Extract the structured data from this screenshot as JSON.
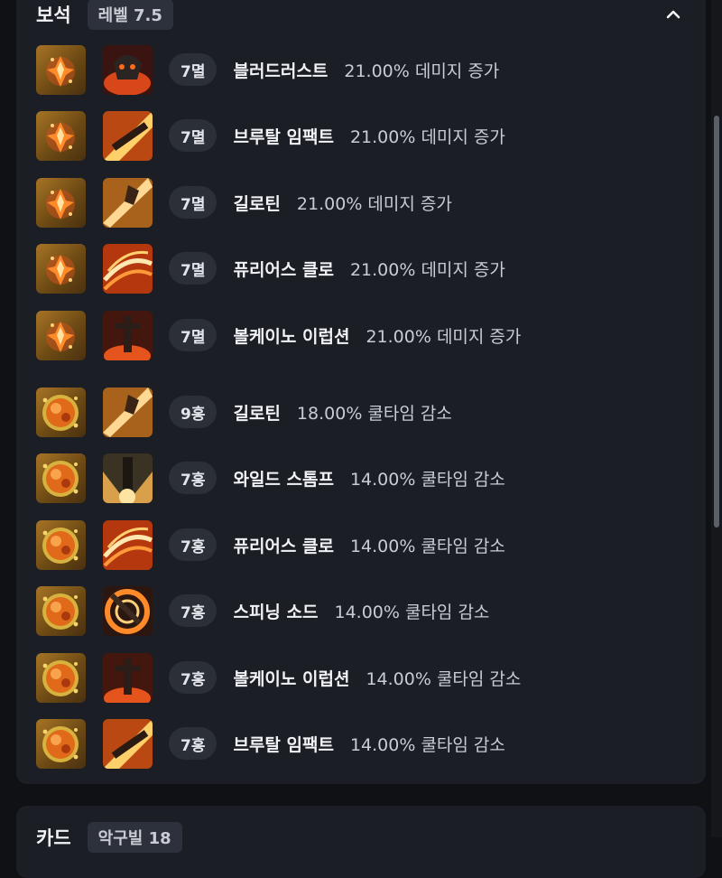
{
  "gem_section": {
    "title": "보석",
    "level_badge": "레벨 7.5",
    "collapse_icon": "chevron-up-icon",
    "rows": [
      {
        "gem_type": "damage-gem-icon",
        "skill_icon": "blood-rust-skill-icon",
        "level": "7멸",
        "skill": "블러드러스트",
        "effect": "21.00% 데미지 증가"
      },
      {
        "gem_type": "damage-gem-icon",
        "skill_icon": "brutal-impact-skill-icon",
        "level": "7멸",
        "skill": "브루탈 임팩트",
        "effect": "21.00% 데미지 증가"
      },
      {
        "gem_type": "damage-gem-icon",
        "skill_icon": "guillotine-skill-icon",
        "level": "7멸",
        "skill": "길로틴",
        "effect": "21.00% 데미지 증가"
      },
      {
        "gem_type": "damage-gem-icon",
        "skill_icon": "furious-claw-skill-icon",
        "level": "7멸",
        "skill": "퓨리어스 클로",
        "effect": "21.00% 데미지 증가"
      },
      {
        "gem_type": "damage-gem-icon",
        "skill_icon": "volcano-eruption-skill-icon",
        "level": "7멸",
        "skill": "볼케이노 이럽션",
        "effect": "21.00% 데미지 증가"
      },
      {
        "gem_type": "cooldown-gem-icon",
        "skill_icon": "guillotine-skill-icon",
        "level": "9홍",
        "skill": "길로틴",
        "effect": "18.00% 쿨타임 감소"
      },
      {
        "gem_type": "cooldown-gem-icon",
        "skill_icon": "wild-stomp-skill-icon",
        "level": "7홍",
        "skill": "와일드 스톰프",
        "effect": "14.00% 쿨타임 감소"
      },
      {
        "gem_type": "cooldown-gem-icon",
        "skill_icon": "furious-claw-skill-icon",
        "level": "7홍",
        "skill": "퓨리어스 클로",
        "effect": "14.00% 쿨타임 감소"
      },
      {
        "gem_type": "cooldown-gem-icon",
        "skill_icon": "spinning-sword-skill-icon",
        "level": "7홍",
        "skill": "스피닝 소드",
        "effect": "14.00% 쿨타임 감소"
      },
      {
        "gem_type": "cooldown-gem-icon",
        "skill_icon": "volcano-eruption-skill-icon",
        "level": "7홍",
        "skill": "볼케이노 이럽션",
        "effect": "14.00% 쿨타임 감소"
      },
      {
        "gem_type": "cooldown-gem-icon",
        "skill_icon": "brutal-impact-skill-icon",
        "level": "7홍",
        "skill": "브루탈 임팩트",
        "effect": "14.00% 쿨타임 감소"
      }
    ]
  },
  "card_section": {
    "title": "카드",
    "badge": "악구빌 18"
  },
  "colors": {
    "background": "#0f1115",
    "card": "#1b1e25",
    "pill": "#2b2f38",
    "text": "#f1f2f5",
    "muted": "#c9ccd3"
  }
}
